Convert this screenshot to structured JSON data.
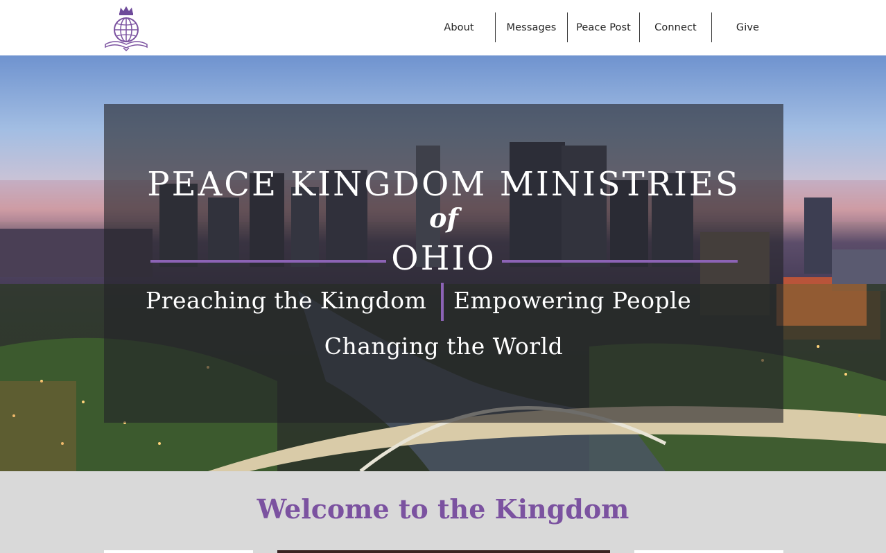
{
  "header": {
    "logo_label": "Peace Kingdom Ministries logo",
    "nav": [
      {
        "label": "About"
      },
      {
        "label": "Messages"
      },
      {
        "label": "Peace Post"
      },
      {
        "label": "Connect"
      },
      {
        "label": "Give"
      }
    ]
  },
  "hero": {
    "title": "PEACE KINGDOM MINISTRIES",
    "of": "of",
    "location": "OHIO",
    "tagline_left": "Preaching the Kingdom",
    "tagline_right": "Empowering People",
    "tagline_bottom": "Changing the World"
  },
  "welcome": {
    "title": "Welcome to the Kingdom"
  },
  "colors": {
    "accent_purple": "#8c63b5",
    "heading_purple": "#7b52a0",
    "section_gray": "#d9d9d9"
  }
}
